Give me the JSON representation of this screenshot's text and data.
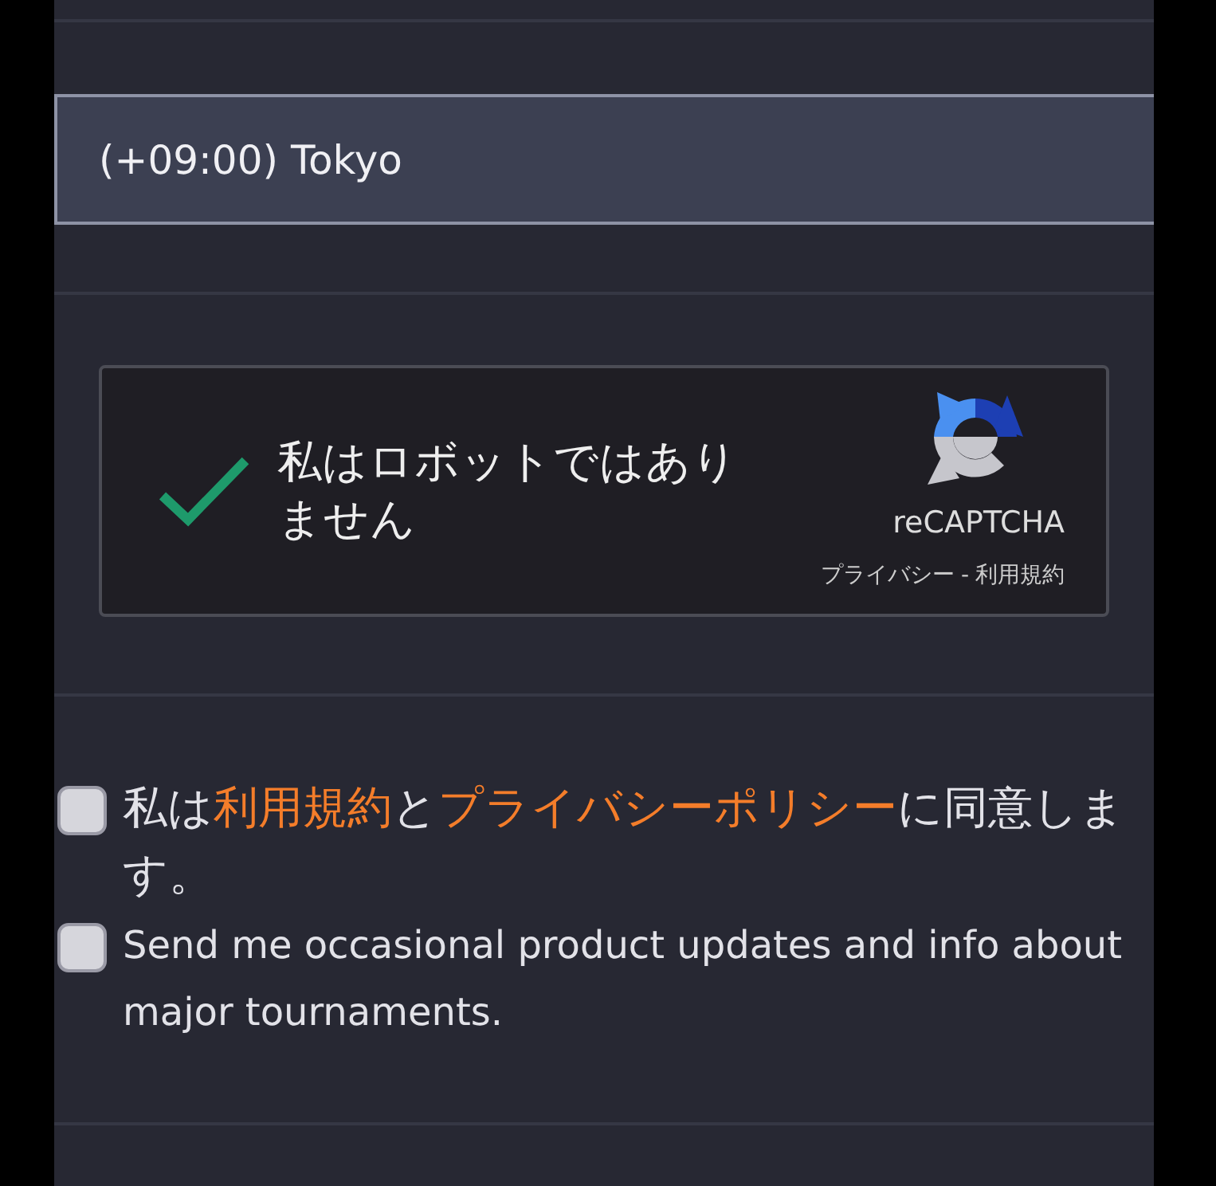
{
  "timezone_field": {
    "value": "(+09:00) Tokyo"
  },
  "captcha": {
    "checked": true,
    "label": "私はロボットではありません",
    "brand": "reCAPTCHA",
    "privacy_link": "プライバシー",
    "separator": "-",
    "terms_link": "利用規約"
  },
  "agreements": [
    {
      "kind": "japanese",
      "checked": false,
      "segments": [
        {
          "text": "私は",
          "link": false
        },
        {
          "text": "利用規約",
          "link": true
        },
        {
          "text": "と",
          "link": false
        },
        {
          "text": "プライバシーポリシー",
          "link": true
        },
        {
          "text": "に同意します。",
          "link": false
        }
      ]
    },
    {
      "kind": "english",
      "checked": false,
      "segments": [
        {
          "text": "Send me occasional product updates and info about major tournaments.",
          "link": false
        }
      ]
    }
  ]
}
